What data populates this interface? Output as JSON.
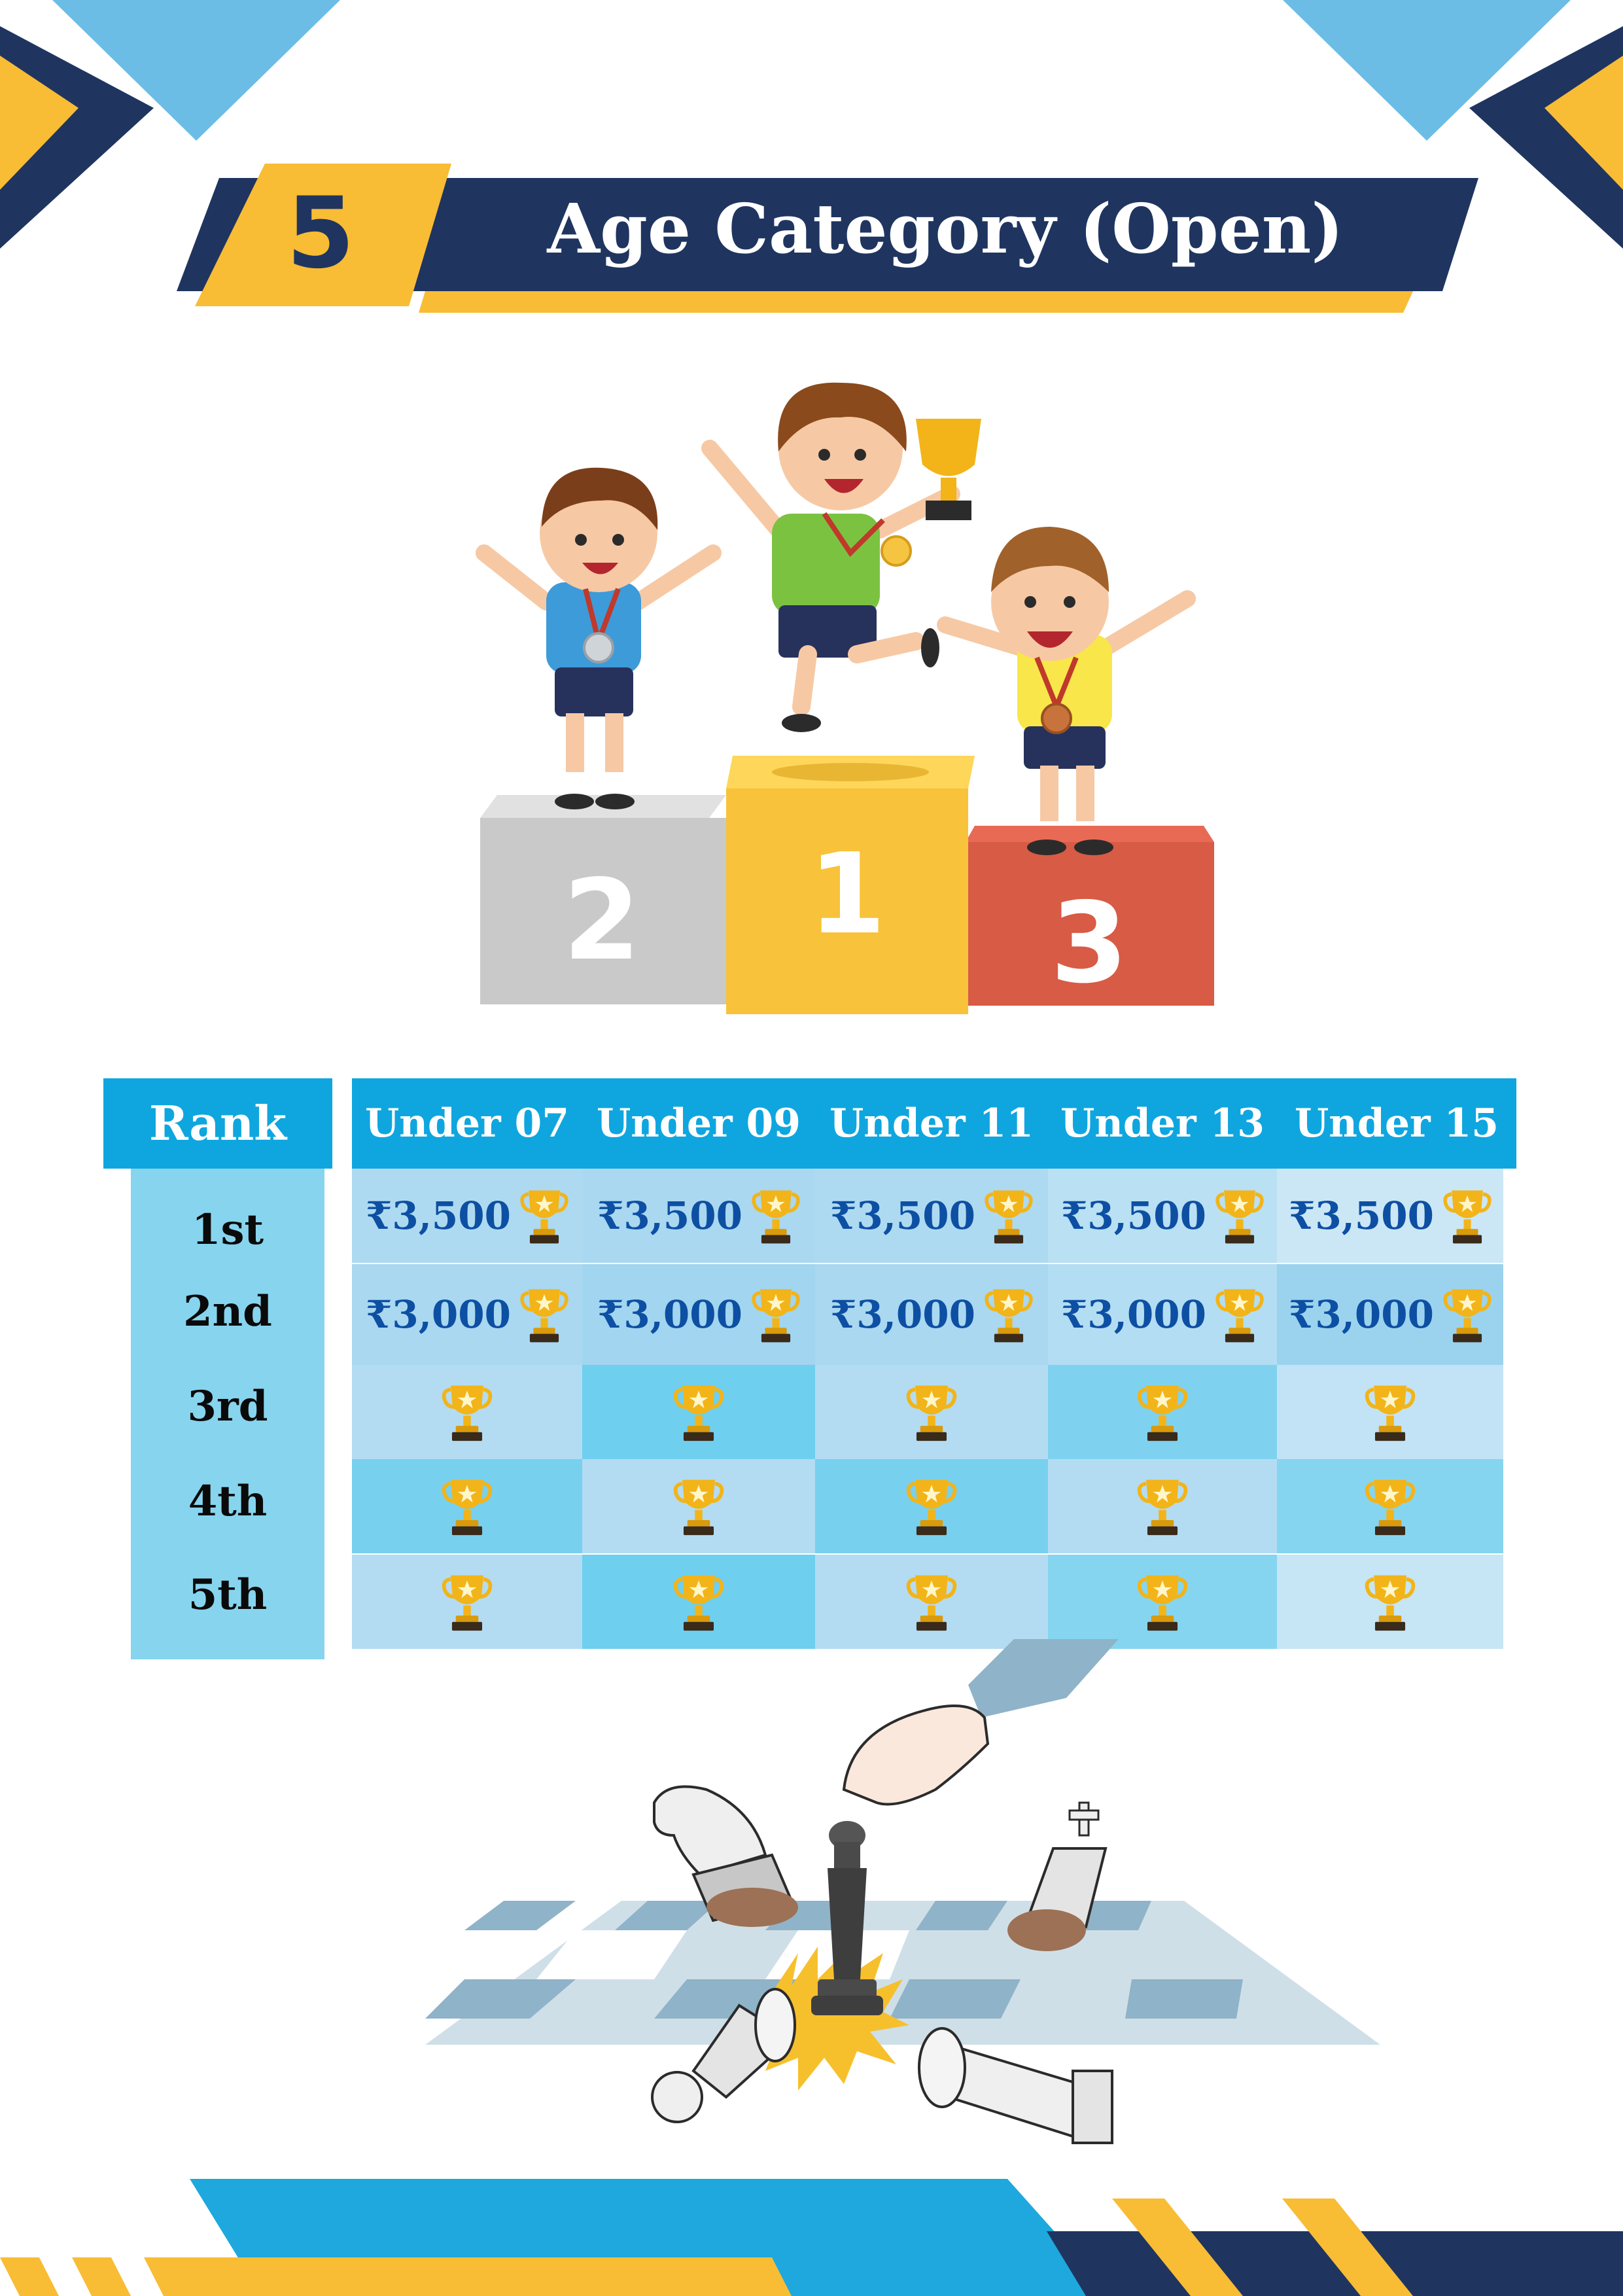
{
  "header": {
    "number": "5",
    "title": "Age Category (Open)"
  },
  "podium": {
    "second": "2",
    "first": "1",
    "third": "3"
  },
  "table": {
    "rank_header": "Rank",
    "columns": [
      "Under 07",
      "Under 09",
      "Under 11",
      "Under 13",
      "Under 15"
    ],
    "rows": [
      {
        "rank": "1st",
        "prizes": [
          "₹3,500",
          "₹3,500",
          "₹3,500",
          "₹3,500",
          "₹3,500"
        ]
      },
      {
        "rank": "2nd",
        "prizes": [
          "₹3,000",
          "₹3,000",
          "₹3,000",
          "₹3,000",
          "₹3,000"
        ]
      },
      {
        "rank": "3rd",
        "prizes": [
          "",
          "",
          "",
          "",
          ""
        ]
      },
      {
        "rank": "4th",
        "prizes": [
          "",
          "",
          "",
          "",
          ""
        ]
      },
      {
        "rank": "5th",
        "prizes": [
          "",
          "",
          "",
          "",
          ""
        ]
      }
    ]
  },
  "colors": {
    "navy": "#1f3560",
    "yellow": "#f8bc35",
    "sky": "#6bbde6",
    "header_blue": "#0fa6df",
    "prize_text": "#0d4fa3",
    "trophy_gold": "#f2b418"
  },
  "icons": {
    "trophy": "trophy-icon",
    "podium": "podium-illustration",
    "chess": "chess-illustration"
  }
}
